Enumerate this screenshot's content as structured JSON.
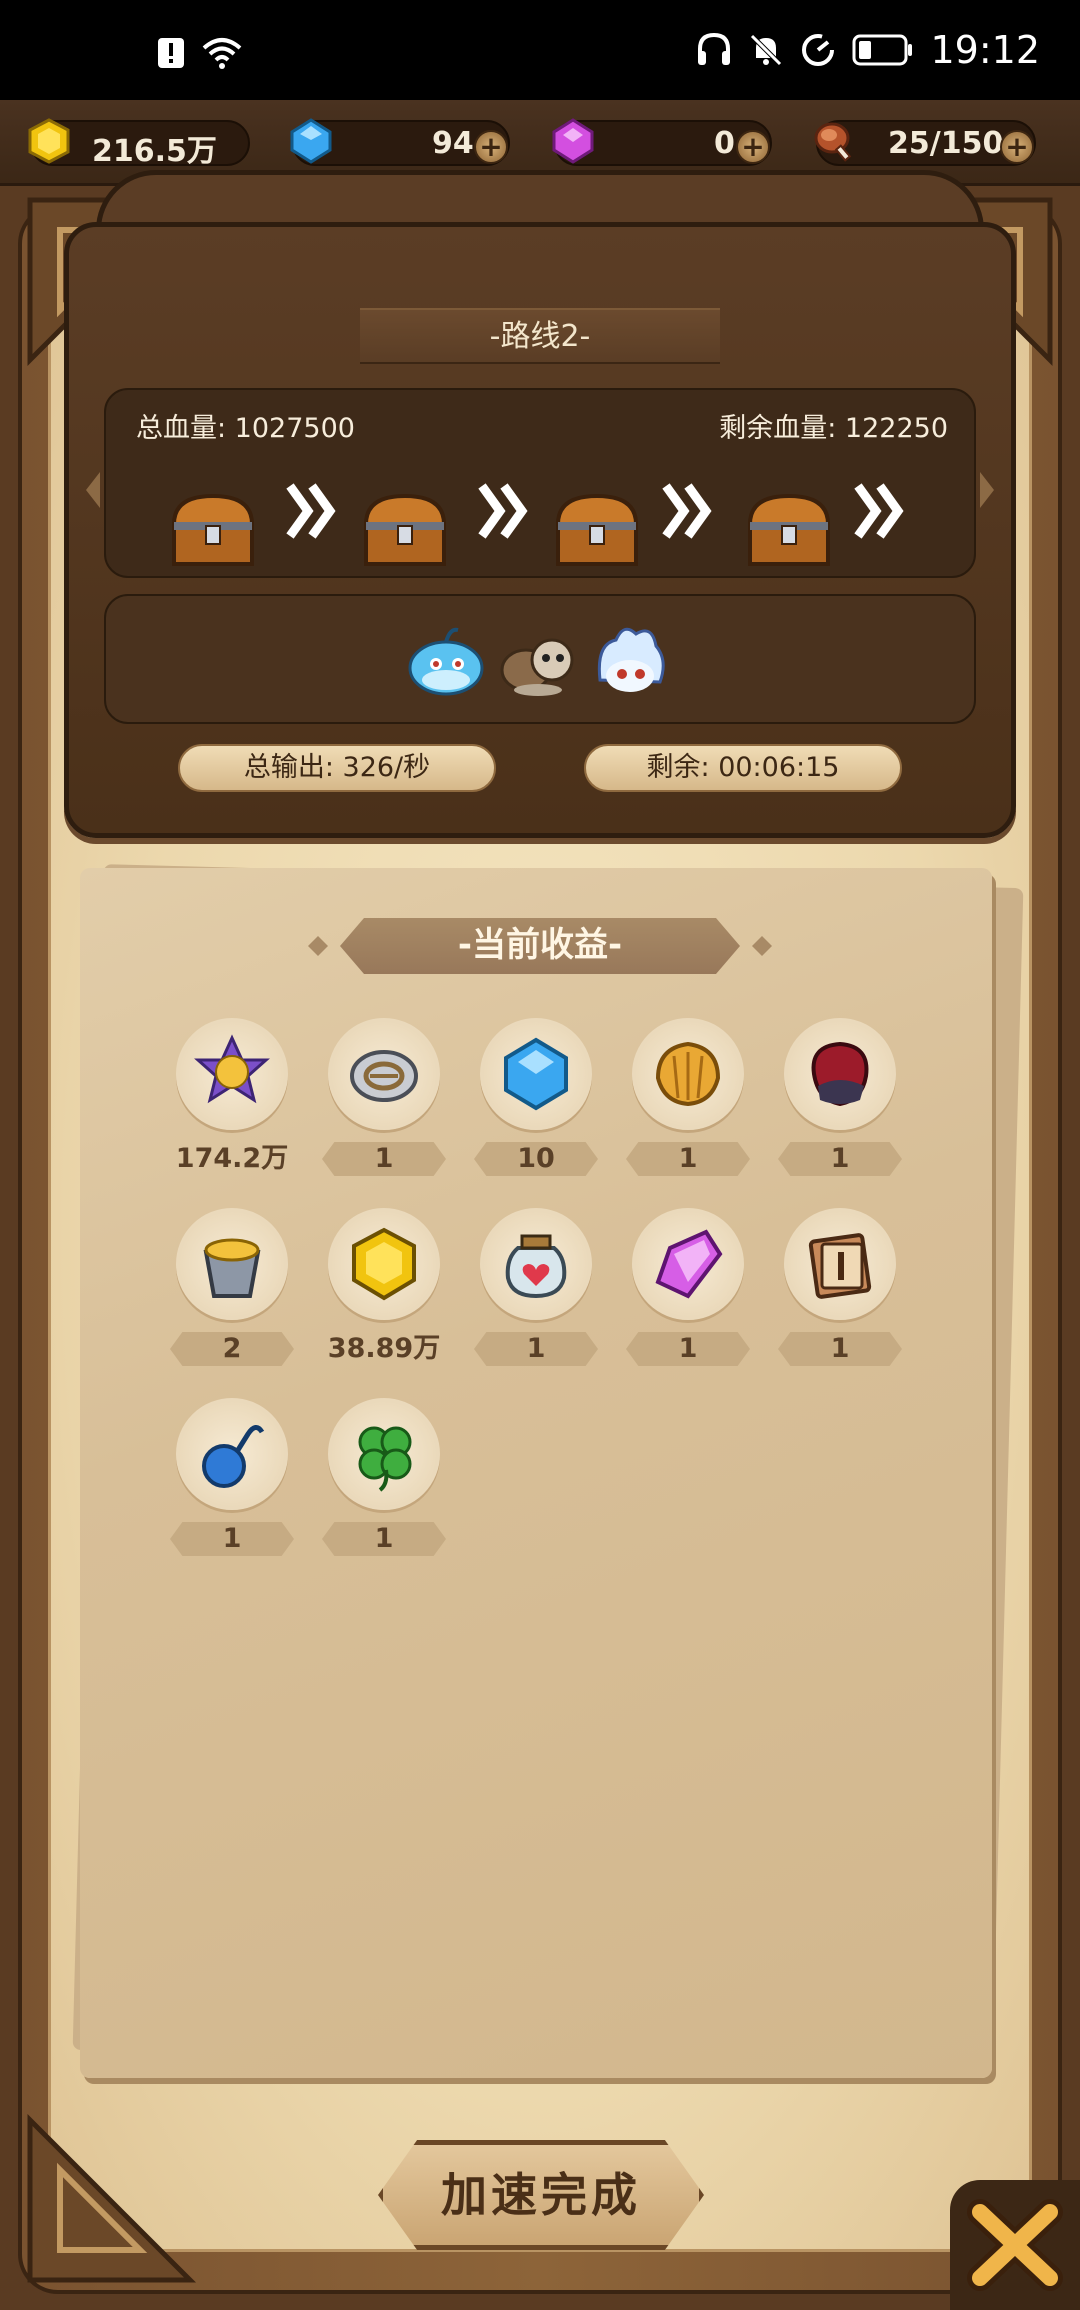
{
  "status_bar": {
    "time": "19:12"
  },
  "resources": {
    "gold": "216.5万",
    "diamond": "94",
    "purple_gem": "0",
    "stamina": "25/150"
  },
  "route": {
    "title": "-路线2-",
    "total_hp": "总血量: 1027500",
    "remaining_hp": "剩余血量: 122250",
    "total_output": "总输出: 326/秒",
    "remaining_time": "剩余: 00:06:15"
  },
  "rewards": {
    "title": "-当前收益-",
    "items": [
      {
        "icon": "exp-badge-icon",
        "qty": "174.2万"
      },
      {
        "icon": "silver-disc-icon",
        "qty": "1"
      },
      {
        "icon": "blue-diamond-icon",
        "qty": "10"
      },
      {
        "icon": "golden-shell-icon",
        "qty": "1"
      },
      {
        "icon": "red-ore-icon",
        "qty": "1"
      },
      {
        "icon": "gold-bucket-icon",
        "qty": "2"
      },
      {
        "icon": "gold-coin-icon",
        "qty": "38.89万"
      },
      {
        "icon": "heart-jar-icon",
        "qty": "1"
      },
      {
        "icon": "purple-crystal-icon",
        "qty": "1"
      },
      {
        "icon": "scroll-card-icon",
        "qty": "1"
      },
      {
        "icon": "hook-bomb-icon",
        "qty": "1"
      },
      {
        "icon": "clover-icon",
        "qty": "1"
      }
    ]
  },
  "buttons": {
    "speed_up": "加速完成"
  }
}
